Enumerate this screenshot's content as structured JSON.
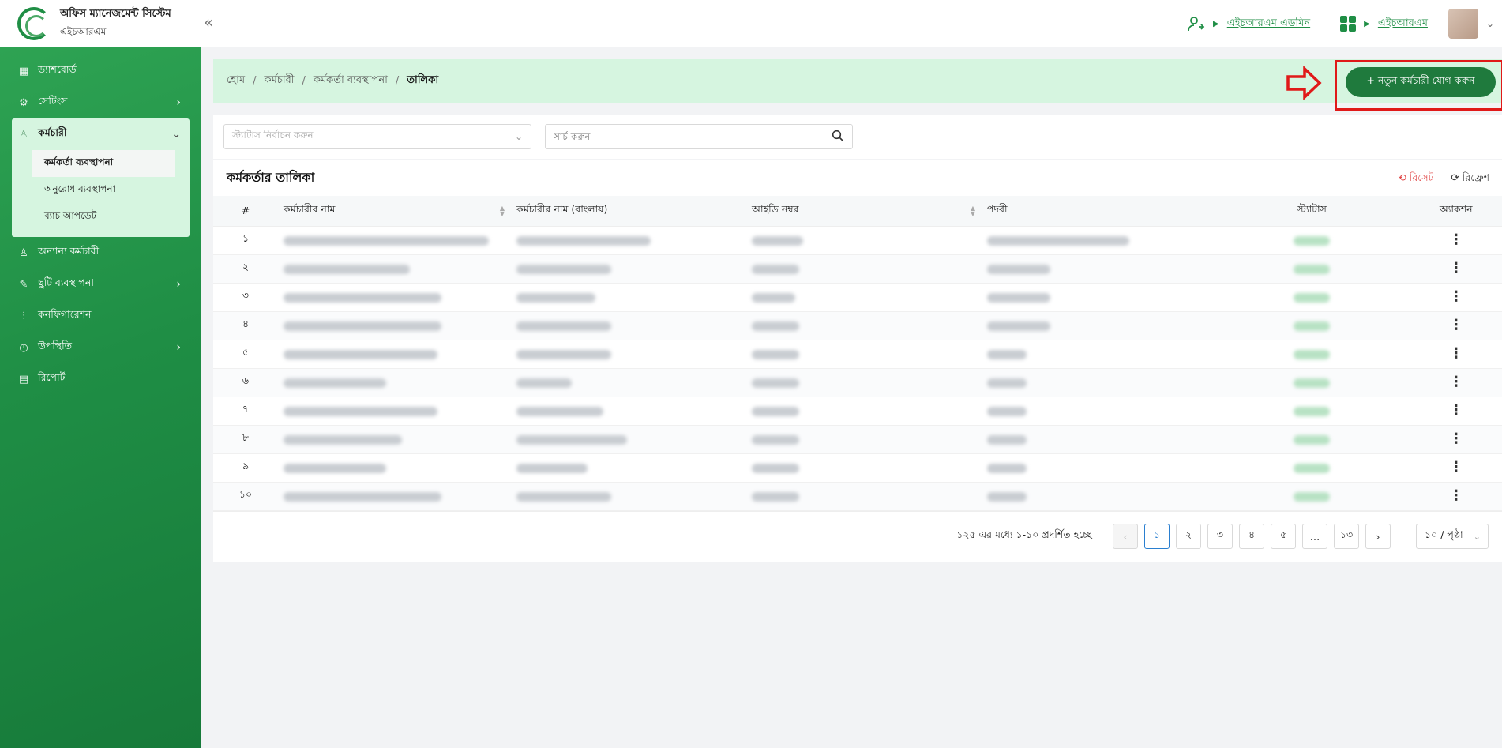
{
  "header": {
    "app_title": "অফিস ম্যানেজমেন্ট সিস্টেম",
    "app_subtitle": "এইচআরএম",
    "role_link": "এইচআরএম এডমিন",
    "module_link": "এইচআরএম"
  },
  "sidebar": {
    "items": [
      {
        "label": "ড্যাশবোর্ড",
        "icon": "dashboard-icon"
      },
      {
        "label": "সেটিংস",
        "icon": "gear-icon"
      },
      {
        "label": "কর্মচারী",
        "icon": "user-icon"
      },
      {
        "label": "অন্যান্য কর্মচারী",
        "icon": "users-icon"
      },
      {
        "label": "ছুটি ব্যবস্থাপনা",
        "icon": "leaf-icon"
      },
      {
        "label": "কনফিগারেশন",
        "icon": "sliders-icon"
      },
      {
        "label": "উপস্থিতি",
        "icon": "clock-icon"
      },
      {
        "label": "রিপোর্ট",
        "icon": "document-icon"
      }
    ],
    "sub_items": [
      "কর্মকর্তা ব্যবস্থাপনা",
      "অনুরোধ ব্যবস্থাপনা",
      "ব্যাচ আপডেট"
    ]
  },
  "breadcrumb": [
    "হোম",
    "কর্মচারী",
    "কর্মকর্তা ব্যবস্থাপনা",
    "তালিকা"
  ],
  "add_button": "+ নতুন কর্মচারী যোগ করুন",
  "filters": {
    "status_placeholder": "স্ট্যাটাস নির্বাচন করুন",
    "search_placeholder": "সার্চ করুন"
  },
  "table": {
    "title": "কর্মকর্তার তালিকা",
    "reset_label": "রিসেট",
    "refresh_label": "রিফ্রেশ",
    "columns": [
      "#",
      "কর্মচারীর নাম",
      "কর্মচারীর নাম (বাংলায়)",
      "আইডি নম্বর",
      "পদবী",
      "স্ট্যাটাস",
      "অ্যাকশন"
    ],
    "row_numbers": [
      "১",
      "২",
      "৩",
      "৪",
      "৫",
      "৬",
      "৭",
      "৮",
      "৯",
      "১০"
    ]
  },
  "pagination": {
    "info": "১২৫ এর মধ্যে ১-১০ প্রদর্শিত হচ্ছে",
    "pages": [
      "১",
      "২",
      "৩",
      "৪",
      "৫",
      "…",
      "১৩"
    ],
    "page_size": "১০ / পৃষ্ঠা"
  },
  "colors": {
    "primary": "#1f8e45",
    "highlight": "#e01919"
  }
}
